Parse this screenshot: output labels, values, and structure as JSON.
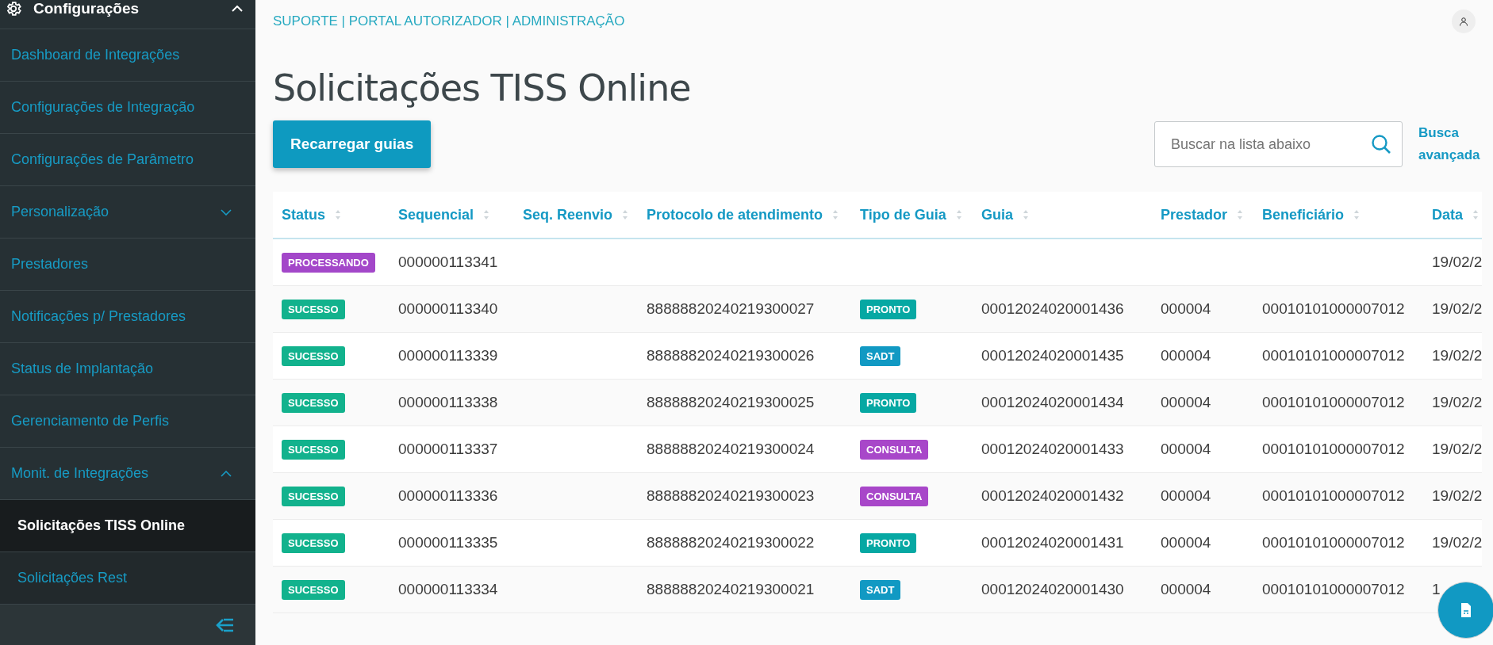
{
  "sidebar": {
    "header": {
      "title": "Configurações",
      "expanded": true
    },
    "items": [
      {
        "label": "Dashboard de Integrações",
        "selected": false
      },
      {
        "label": "Configurações de Integração",
        "selected": false
      },
      {
        "label": "Configurações de Parâmetro",
        "selected": false
      },
      {
        "label": "Personalização",
        "selected": false,
        "expanded": false
      },
      {
        "label": "Prestadores",
        "selected": false
      },
      {
        "label": "Notificações p/ Prestadores",
        "selected": false
      },
      {
        "label": "Status de Implantação",
        "selected": false
      },
      {
        "label": "Gerenciamento de Perfis",
        "selected": false
      },
      {
        "label": "Monit. de Integrações",
        "selected": false,
        "expanded": true,
        "children": [
          {
            "label": "Solicitações TISS Online",
            "selected": true
          },
          {
            "label": "Solicitações Rest",
            "selected": false
          }
        ]
      }
    ]
  },
  "breadcrumb": "SUPORTE | PORTAL AUTORIZADOR | ADMINISTRAÇÃO",
  "title": "Solicitações TISS Online",
  "reload_button": "Recarregar guias",
  "search": {
    "placeholder": "Buscar na lista abaixo"
  },
  "advanced_search": "Busca avançada",
  "table": {
    "columns": [
      "Status",
      "Sequencial",
      "Seq. Reenvio",
      "Protocolo de atendimento",
      "Tipo de Guia",
      "Guia",
      "Prestador",
      "Beneficiário",
      "Data"
    ],
    "rows": [
      {
        "status": {
          "label": "PROCESSANDO",
          "color": "#a347c9"
        },
        "sequencial": "000000113341",
        "data": "19/02/2"
      },
      {
        "status": {
          "label": "SUCESSO",
          "color": "#12b28d"
        },
        "sequencial": "000000113340",
        "protocolo": "88888820240219300027",
        "tipo": {
          "label": "PRONTO",
          "color": "#06a8a3"
        },
        "guia": "00012024020001436",
        "prestador": "000004",
        "beneficiario": "00010101000007012",
        "data": "19/02/2"
      },
      {
        "status": {
          "label": "SUCESSO",
          "color": "#12b28d"
        },
        "sequencial": "000000113339",
        "protocolo": "88888820240219300026",
        "tipo": {
          "label": "SADT",
          "color": "#1199c3"
        },
        "guia": "00012024020001435",
        "prestador": "000004",
        "beneficiario": "00010101000007012",
        "data": "19/02/2"
      },
      {
        "status": {
          "label": "SUCESSO",
          "color": "#12b28d"
        },
        "sequencial": "000000113338",
        "protocolo": "88888820240219300025",
        "tipo": {
          "label": "PRONTO",
          "color": "#06a8a3"
        },
        "guia": "00012024020001434",
        "prestador": "000004",
        "beneficiario": "00010101000007012",
        "data": "19/02/2"
      },
      {
        "status": {
          "label": "SUCESSO",
          "color": "#12b28d"
        },
        "sequencial": "000000113337",
        "protocolo": "88888820240219300024",
        "tipo": {
          "label": "CONSULTA",
          "color": "#a847c9"
        },
        "guia": "00012024020001433",
        "prestador": "000004",
        "beneficiario": "00010101000007012",
        "data": "19/02/2"
      },
      {
        "status": {
          "label": "SUCESSO",
          "color": "#12b28d"
        },
        "sequencial": "000000113336",
        "protocolo": "88888820240219300023",
        "tipo": {
          "label": "CONSULTA",
          "color": "#a847c9"
        },
        "guia": "00012024020001432",
        "prestador": "000004",
        "beneficiario": "00010101000007012",
        "data": "19/02/2"
      },
      {
        "status": {
          "label": "SUCESSO",
          "color": "#12b28d"
        },
        "sequencial": "000000113335",
        "protocolo": "88888820240219300022",
        "tipo": {
          "label": "PRONTO",
          "color": "#06a8a3"
        },
        "guia": "00012024020001431",
        "prestador": "000004",
        "beneficiario": "00010101000007012",
        "data": "19/02/2"
      },
      {
        "status": {
          "label": "SUCESSO",
          "color": "#12b28d"
        },
        "sequencial": "000000113334",
        "protocolo": "88888820240219300021",
        "tipo": {
          "label": "SADT",
          "color": "#1199c3"
        },
        "guia": "00012024020001430",
        "prestador": "000004",
        "beneficiario": "00010101000007012",
        "data": "1"
      }
    ]
  }
}
